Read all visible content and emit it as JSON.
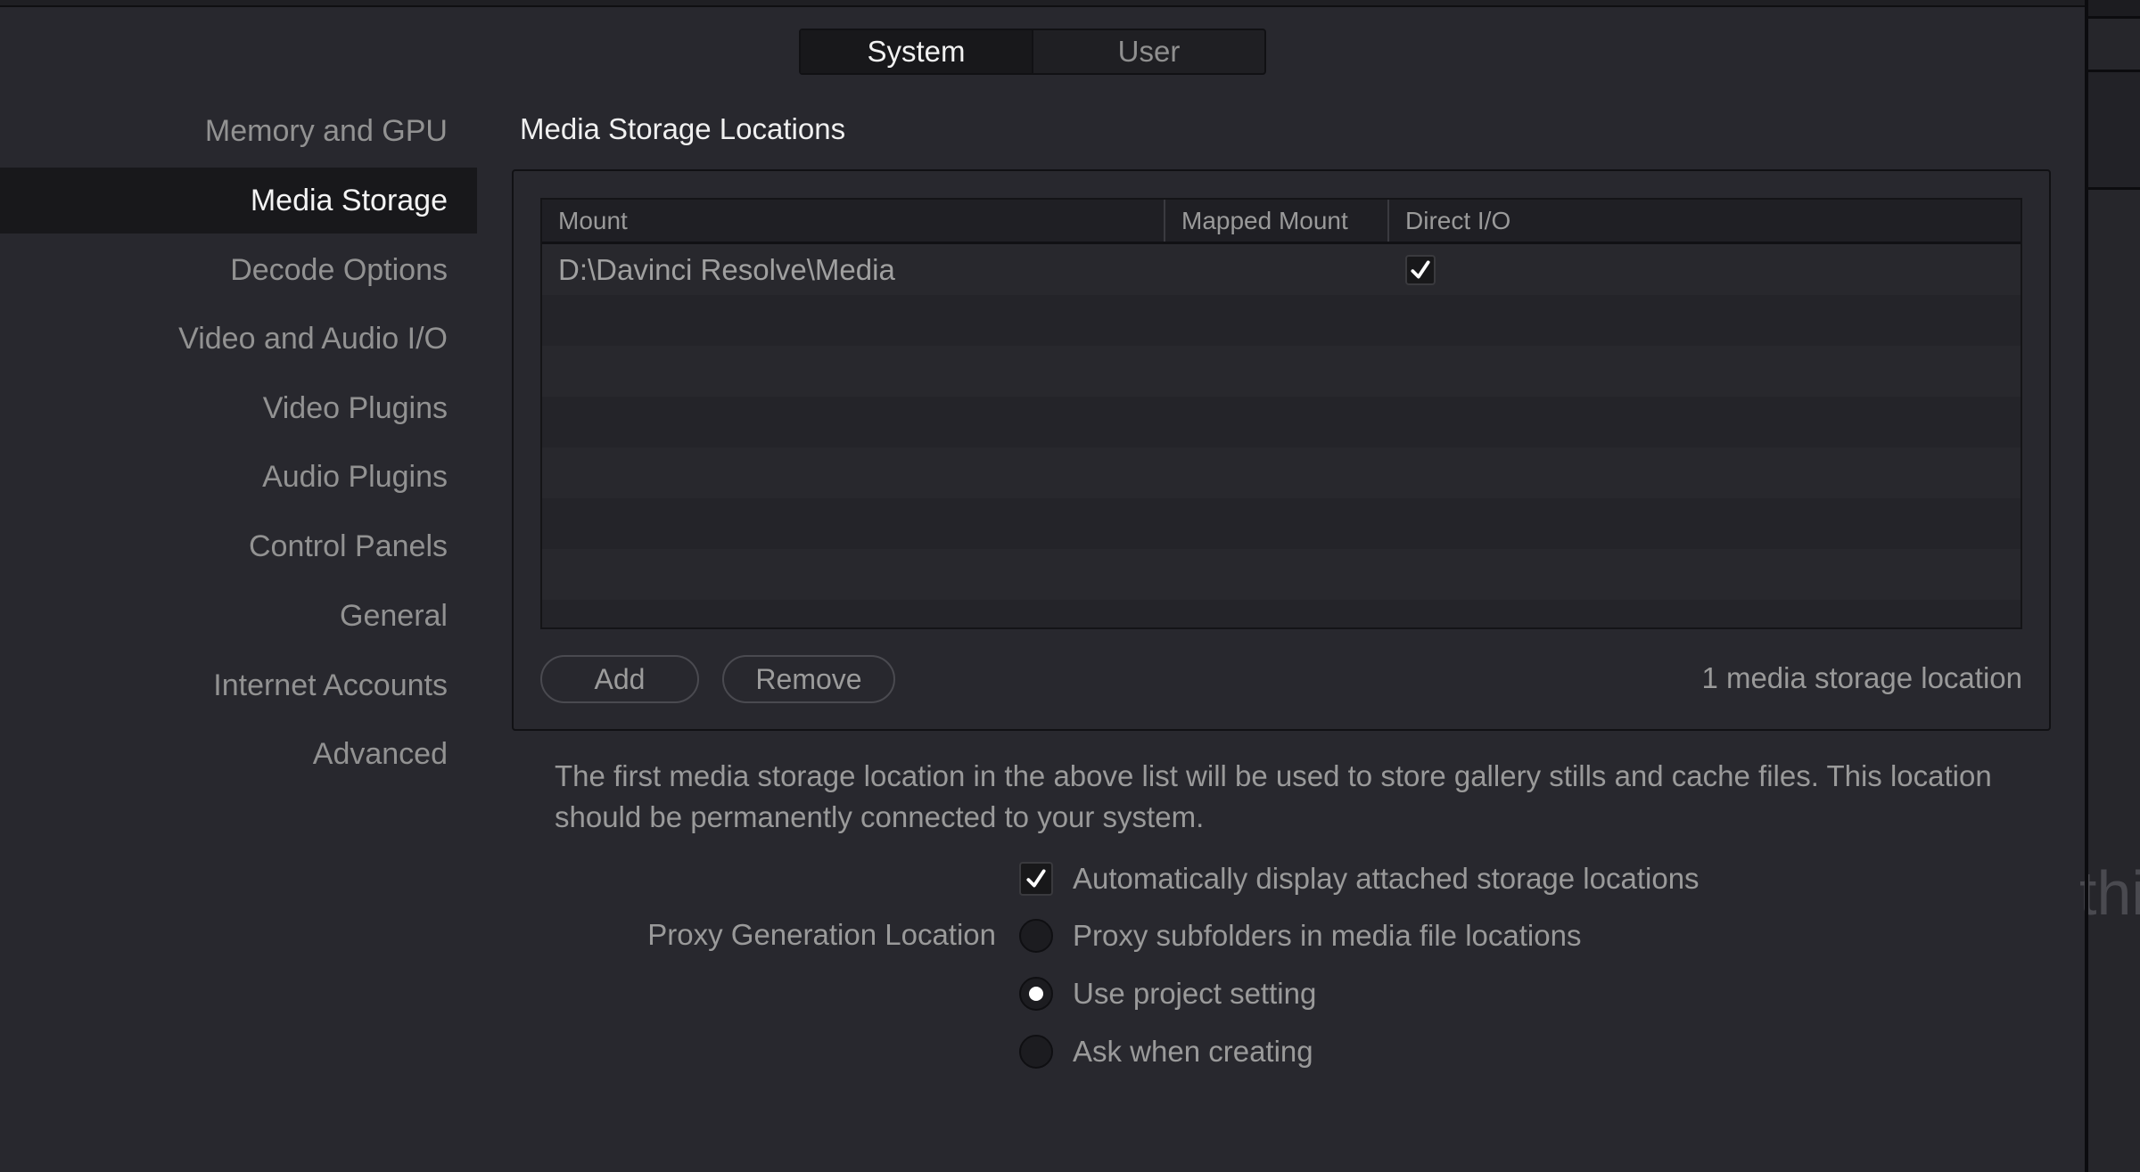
{
  "segmented_control": {
    "tabs": [
      {
        "label": "System",
        "active": true
      },
      {
        "label": "User",
        "active": false
      }
    ]
  },
  "sidebar": {
    "items": [
      {
        "label": "Memory and GPU",
        "active": false
      },
      {
        "label": "Media Storage",
        "active": true
      },
      {
        "label": "Decode Options",
        "active": false
      },
      {
        "label": "Video and Audio I/O",
        "active": false
      },
      {
        "label": "Video Plugins",
        "active": false
      },
      {
        "label": "Audio Plugins",
        "active": false
      },
      {
        "label": "Control Panels",
        "active": false
      },
      {
        "label": "General",
        "active": false
      },
      {
        "label": "Internet Accounts",
        "active": false
      },
      {
        "label": "Advanced",
        "active": false
      }
    ]
  },
  "media_storage": {
    "title": "Media Storage Locations",
    "table": {
      "columns": [
        "Mount",
        "Mapped Mount",
        "Direct I/O"
      ],
      "rows": [
        {
          "mount": "D:\\Davinci Resolve\\Media",
          "mapped_mount": "",
          "direct_io": true
        }
      ],
      "empty_rows": 7
    },
    "buttons": {
      "add": "Add",
      "remove": "Remove"
    },
    "count_text": "1 media storage location",
    "description": "The first media storage location in the above list will be used to store gallery stills and cache files. This location should be permanently connected to your system."
  },
  "options": {
    "auto_display": {
      "label": "Automatically display attached storage locations",
      "checked": true
    },
    "proxy_generation": {
      "label": "Proxy Generation Location",
      "choices": [
        {
          "label": "Proxy subfolders in media file locations",
          "selected": false
        },
        {
          "label": "Use project setting",
          "selected": true
        },
        {
          "label": "Ask when creating",
          "selected": false
        }
      ]
    }
  },
  "right_panel": {
    "ghost_text": "thi"
  },
  "colors": {
    "background": "#28282e",
    "active_item_bg": "#18181b",
    "text_primary": "#f0f0f0",
    "text_secondary": "#9a9a9a"
  }
}
